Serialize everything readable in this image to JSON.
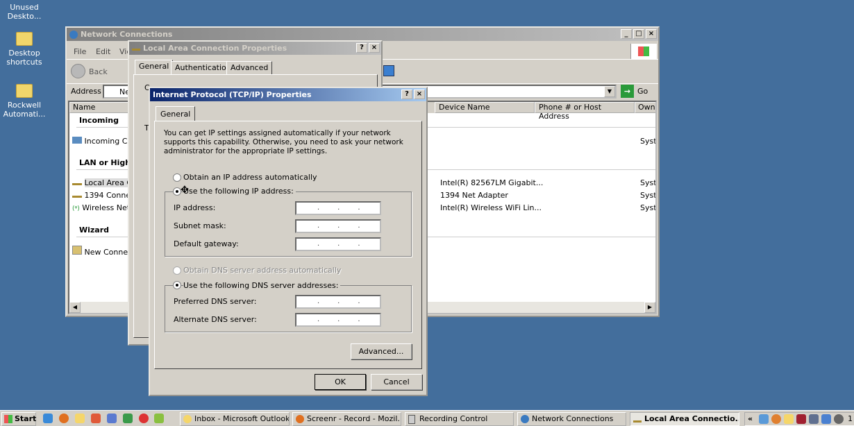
{
  "desktop": {
    "icons": [
      {
        "label": "Unused Deskto..."
      },
      {
        "label": "Desktop shortcuts"
      },
      {
        "label": "Rockwell Automati..."
      }
    ]
  },
  "netconn": {
    "title": "Network Connections",
    "menu": [
      "File",
      "Edit",
      "Vie"
    ],
    "back": "Back",
    "address_label": "Address",
    "address_value": "Net",
    "go": "Go",
    "columns": [
      "Name",
      "Device Name",
      "Phone # or Host Address",
      "Owne"
    ],
    "groups": [
      {
        "name": "Incoming"
      },
      {
        "name": "LAN or High-S"
      },
      {
        "name": "Wizard"
      }
    ],
    "rows": [
      {
        "name": "Incoming Con",
        "device": "",
        "owner": "Syste"
      },
      {
        "name": "Local Area Co",
        "device": "Intel(R) 82567LM Gigabit...",
        "owner": "Syste"
      },
      {
        "name": "1394 Connec",
        "device": "1394 Net Adapter",
        "owner": "Syste"
      },
      {
        "name": "Wireless Netw",
        "device": "Intel(R) Wireless WiFi Lin...",
        "owner": "Syste"
      },
      {
        "name": "New Connect",
        "device": "",
        "owner": ""
      }
    ]
  },
  "lacprops": {
    "title": "Local Area Connection Properties",
    "tabs": [
      "General",
      "Authentication",
      "Advanced"
    ],
    "c_label": "C",
    "t_label": "T"
  },
  "tcpip": {
    "title": "Internet Protocol (TCP/IP) Properties",
    "tab": "General",
    "description": "You can get IP settings assigned automatically if your network supports this capability. Otherwise, you need to ask your network administrator for the appropriate IP settings.",
    "obtain_ip": "Obtain an IP address automatically",
    "use_ip": "Use the following IP address:",
    "ip_label": "IP address:",
    "subnet_label": "Subnet mask:",
    "gateway_label": "Default gateway:",
    "obtain_dns": "Obtain DNS server address automatically",
    "use_dns": "Use the following DNS server addresses:",
    "pref_dns_label": "Preferred DNS server:",
    "alt_dns_label": "Alternate DNS server:",
    "ip_value": "...",
    "subnet_value": "...",
    "gateway_value": "...",
    "pref_dns_value": "...",
    "alt_dns_value": "...",
    "advanced": "Advanced...",
    "ok": "OK",
    "cancel": "Cancel"
  },
  "taskbar": {
    "start": "Start",
    "tasks": [
      "Inbox - Microsoft Outlook",
      "Screenr - Record - Mozil...",
      "Recording Control",
      "Network Connections",
      "Local Area Connectio..."
    ],
    "tray_chevron": "«",
    "clock": "1"
  }
}
